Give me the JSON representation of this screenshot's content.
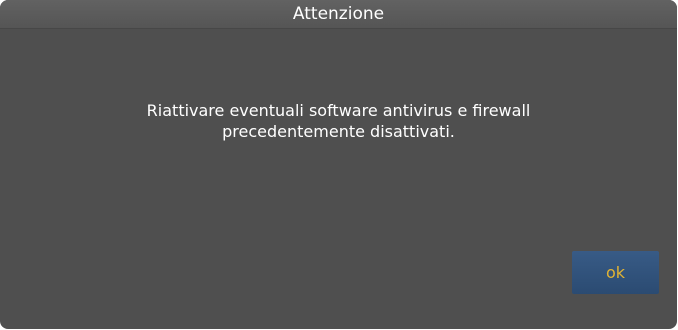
{
  "dialog": {
    "title": "Attenzione",
    "message_line1": "Riattivare eventuali software antivirus e firewall",
    "message_line2": "precedentemente disattivati.",
    "ok_label": "ok"
  },
  "colors": {
    "dialog_background": "#4f4f4f",
    "title_text": "#ffffff",
    "message_text": "#ffffff",
    "button_background": "#2f507a",
    "button_text": "#e1b334"
  }
}
